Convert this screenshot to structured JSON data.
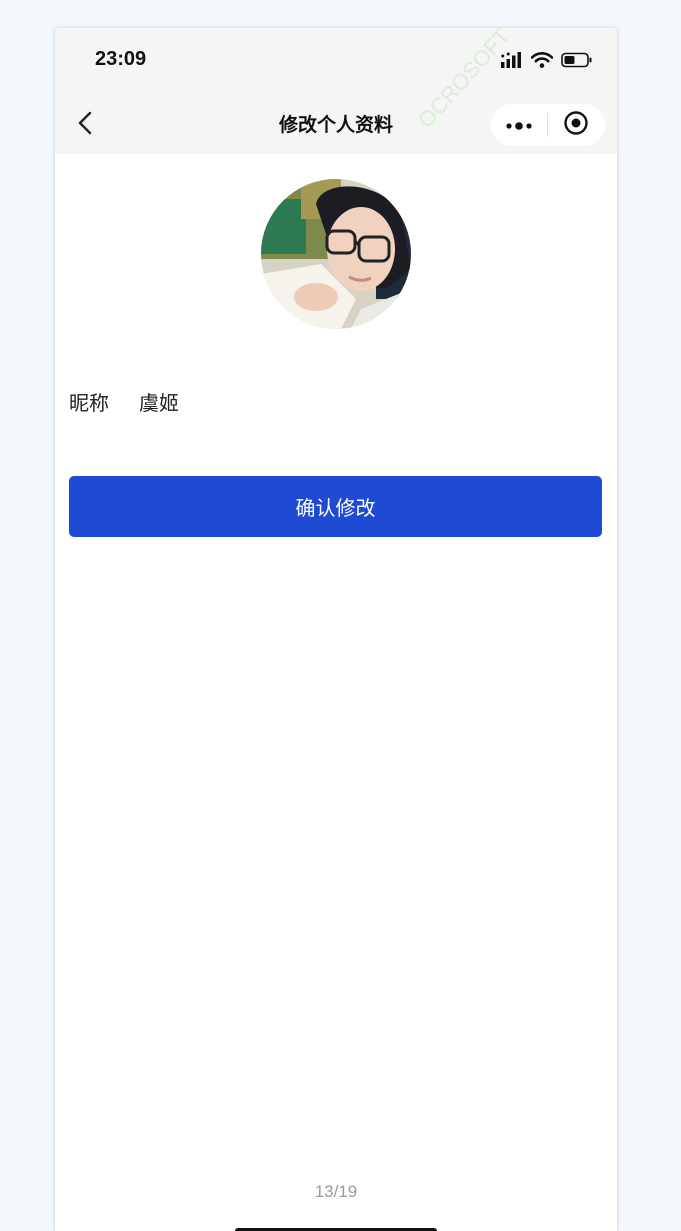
{
  "status_bar": {
    "time": "23:09",
    "icons": [
      "signal-icon",
      "wifi-icon",
      "battery-icon"
    ]
  },
  "nav": {
    "title": "修改个人资料",
    "back_icon": "chevron-left-icon",
    "more_icon": "more-dots-icon",
    "close_icon": "target-circle-icon"
  },
  "watermark": "OCROSOFT",
  "profile": {
    "nickname_label": "昵称",
    "nickname_value": "虞姬"
  },
  "confirm_button": {
    "label": "确认修改"
  },
  "pager": {
    "text": "13/19"
  },
  "colors": {
    "accent": "#1f4ad4",
    "page_bg": "#ffffff",
    "nav_bg": "#f5f5f5"
  }
}
